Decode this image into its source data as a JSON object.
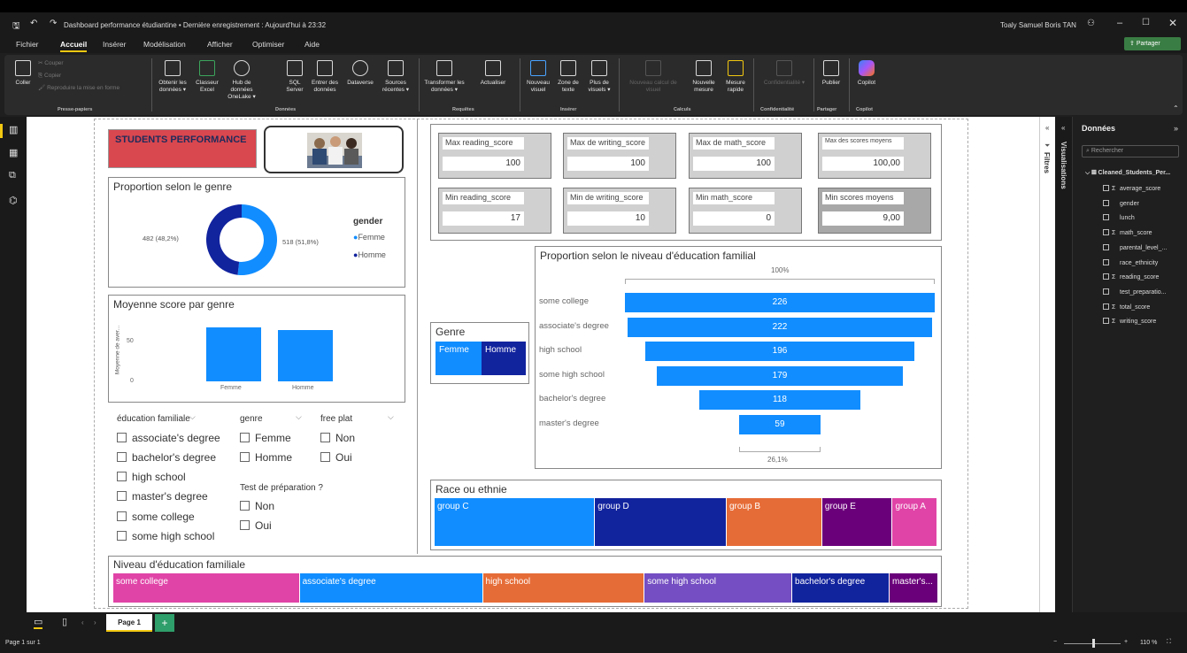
{
  "window": {
    "title": "Dashboard performance étudiantine • Dernière enregistrement : Aujourd'hui à 23:32",
    "user": "Toaly Samuel Boris TAN",
    "share": "Partager"
  },
  "menu": [
    "Fichier",
    "Accueil",
    "Insérer",
    "Modélisation",
    "Afficher",
    "Optimiser",
    "Aide"
  ],
  "ribbon": {
    "clipboard": {
      "paste": "Coller",
      "cut": "Couper",
      "copy": "Copier",
      "format": "Reproduire la mise en forme",
      "group": "Presse-papiers"
    },
    "data": {
      "items": [
        "Obtenir les données ▾",
        "Classeur Excel",
        "Hub de données OneLake ▾",
        "SQL Server",
        "Entrer des données",
        "Dataverse",
        "Sources récentes ▾"
      ],
      "group": "Données"
    },
    "queries": {
      "items": [
        "Transformer les données ▾",
        "Actualiser"
      ],
      "group": "Requêtes"
    },
    "insert": {
      "items": [
        "Nouveau visuel",
        "Zone de texte",
        "Plus de visuels ▾"
      ],
      "group": "Insérer"
    },
    "calc": {
      "items": [
        "Nouveau calcul de visuel",
        "Nouvelle mesure",
        "Mesure rapide"
      ],
      "group": "Calculs"
    },
    "sens": {
      "items": [
        "Confidentialité ▾"
      ],
      "group": "Confidentialité"
    },
    "share": {
      "items": [
        "Publier"
      ],
      "group": "Partager"
    },
    "copilot": {
      "items": [
        "Copilot"
      ],
      "group": "Copilot"
    }
  },
  "report": {
    "header": "STUDENTS PERFORMANCE",
    "donut": {
      "title": "Proportion selon le genre",
      "legend_title": "gender",
      "left_label": "482 (48,2%)",
      "right_label": "518 (51,8%)",
      "legend": [
        "Femme",
        "Homme"
      ],
      "values": [
        518,
        482
      ],
      "colors": [
        "#118dff",
        "#12239e"
      ]
    },
    "avgbar": {
      "title": "Moyenne score par genre",
      "ylabel": "Moyenne de aver...",
      "ticks": [
        "50",
        "0"
      ],
      "categories": [
        "Femme",
        "Homme"
      ]
    },
    "slicers": {
      "edu_title": "éducation familiale",
      "edu": [
        "associate's degree",
        "bachelor's degree",
        "high school",
        "master's degree",
        "some college",
        "some high school"
      ],
      "genre_title": "genre",
      "genre": [
        "Femme",
        "Homme"
      ],
      "lunch_title": "free plat",
      "lunch": [
        "Non",
        "Oui"
      ],
      "prep_title": "Test de préparation ?",
      "prep": [
        "Non",
        "Oui"
      ]
    },
    "kpis": [
      {
        "label": "Max reading_score",
        "value": "100"
      },
      {
        "label": "Max de writing_score",
        "value": "100"
      },
      {
        "label": "Max de math_score",
        "value": "100"
      },
      {
        "label": "Max des scores moyens",
        "value": "100,00"
      },
      {
        "label": "Min reading_score",
        "value": "17"
      },
      {
        "label": "Min de writing_score",
        "value": "10"
      },
      {
        "label": "Min math_score",
        "value": "0"
      },
      {
        "label": "Min scores moyens",
        "value": "9,00"
      }
    ],
    "genre_slicer": {
      "title": "Genre",
      "items": [
        "Femme",
        "Homme"
      ]
    },
    "funnel": {
      "title": "Proportion selon le niveau d'éducation familial",
      "top": "100%",
      "bottom": "26,1%",
      "categories": [
        "some college",
        "associate's degree",
        "high school",
        "some high school",
        "bachelor's degree",
        "master's degree"
      ],
      "values": [
        226,
        222,
        196,
        179,
        118,
        59
      ]
    },
    "race": {
      "title": "Race ou ethnie",
      "items": [
        {
          "label": "group C",
          "value": 319,
          "color": "#118dff"
        },
        {
          "label": "group D",
          "value": 262,
          "color": "#12239e"
        },
        {
          "label": "group B",
          "value": 190,
          "color": "#e66c37"
        },
        {
          "label": "group E",
          "value": 140,
          "color": "#6b007b"
        },
        {
          "label": "group A",
          "value": 89,
          "color": "#e044a7"
        }
      ]
    },
    "edu_tree": {
      "title": "Niveau d'éducation familiale",
      "items": [
        {
          "label": "some college",
          "value": 226,
          "color": "#e044a7"
        },
        {
          "label": "associate's degree",
          "value": 222,
          "color": "#118dff"
        },
        {
          "label": "high school",
          "value": 196,
          "color": "#e66c37"
        },
        {
          "label": "some high school",
          "value": 179,
          "color": "#744ec2"
        },
        {
          "label": "bachelor's degree",
          "value": 118,
          "color": "#12239e"
        },
        {
          "label": "master's...",
          "value": 59,
          "color": "#6b007b"
        }
      ]
    }
  },
  "panes": {
    "filters": "Filtres",
    "visuals": "Visualisations",
    "data_title": "Données",
    "search": "Rechercher",
    "table": "Cleaned_Students_Per...",
    "fields": [
      {
        "name": "average_score",
        "sigma": true
      },
      {
        "name": "gender",
        "sigma": false
      },
      {
        "name": "lunch",
        "sigma": false
      },
      {
        "name": "math_score",
        "sigma": true
      },
      {
        "name": "parental_level_...",
        "sigma": false
      },
      {
        "name": "race_ethnicity",
        "sigma": false
      },
      {
        "name": "reading_score",
        "sigma": true
      },
      {
        "name": "test_preparatio...",
        "sigma": false
      },
      {
        "name": "total_score",
        "sigma": true
      },
      {
        "name": "writing_score",
        "sigma": true
      }
    ]
  },
  "pages": {
    "current": "Page 1",
    "status": "Page 1 sur 1",
    "zoom": "110 %"
  }
}
